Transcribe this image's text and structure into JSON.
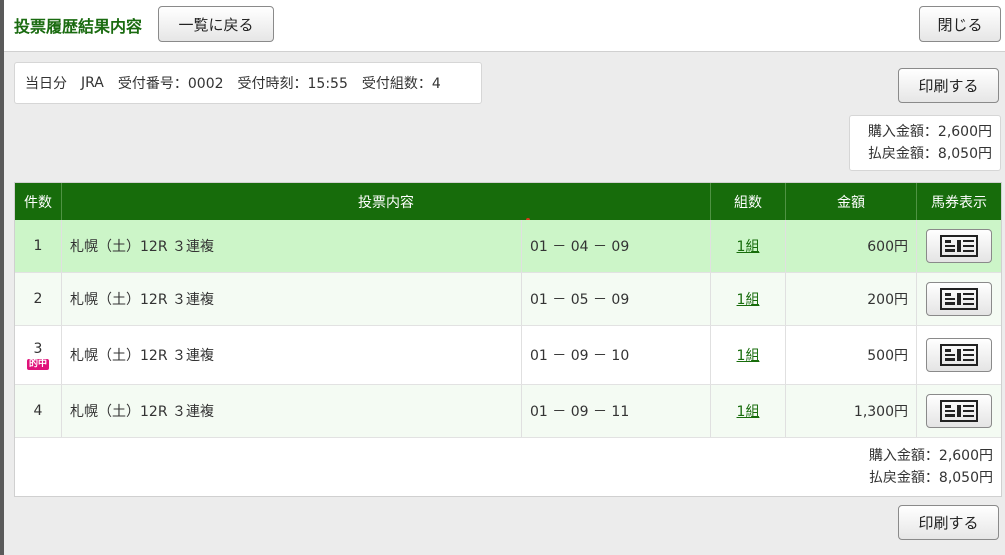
{
  "header": {
    "title": "投票履歴結果内容",
    "back_label": "一覧に戻る",
    "close_label": "閉じる"
  },
  "info": {
    "day": "当日分",
    "org": "JRA",
    "receipt_no": "受付番号：0002",
    "receipt_time": "受付時刻：15:55",
    "receipt_sets": "受付組数：4"
  },
  "print_label": "印刷する",
  "summary": {
    "purchase": "購入金額：2,600円",
    "payout": "払戻金額：8,050円"
  },
  "table": {
    "headers": {
      "count": "件数",
      "content": "投票内容",
      "sets": "組数",
      "amount": "金額",
      "ticket": "馬券表示"
    },
    "rows": [
      {
        "no": "1",
        "race": "札幌（土）12R ３連複",
        "combo": "01 － 04 － 09",
        "sets": "1組",
        "amount": "600円",
        "hit": ""
      },
      {
        "no": "2",
        "race": "札幌（土）12R ３連複",
        "combo": "01 － 05 － 09",
        "sets": "1組",
        "amount": "200円",
        "hit": ""
      },
      {
        "no": "3",
        "race": "札幌（土）12R ３連複",
        "combo": "01 － 09 － 10",
        "sets": "1組",
        "amount": "500円",
        "hit": "的中"
      },
      {
        "no": "4",
        "race": "札幌（土）12R ３連複",
        "combo": "01 － 09 － 11",
        "sets": "1組",
        "amount": "1,300円",
        "hit": ""
      }
    ]
  },
  "footer": {
    "purchase": "購入金額：2,600円",
    "payout": "払戻金額：8,050円"
  },
  "colors": {
    "accent": "#176c0b",
    "highlight_row": "#ccf5c8",
    "hit_badge": "#e0127a"
  }
}
